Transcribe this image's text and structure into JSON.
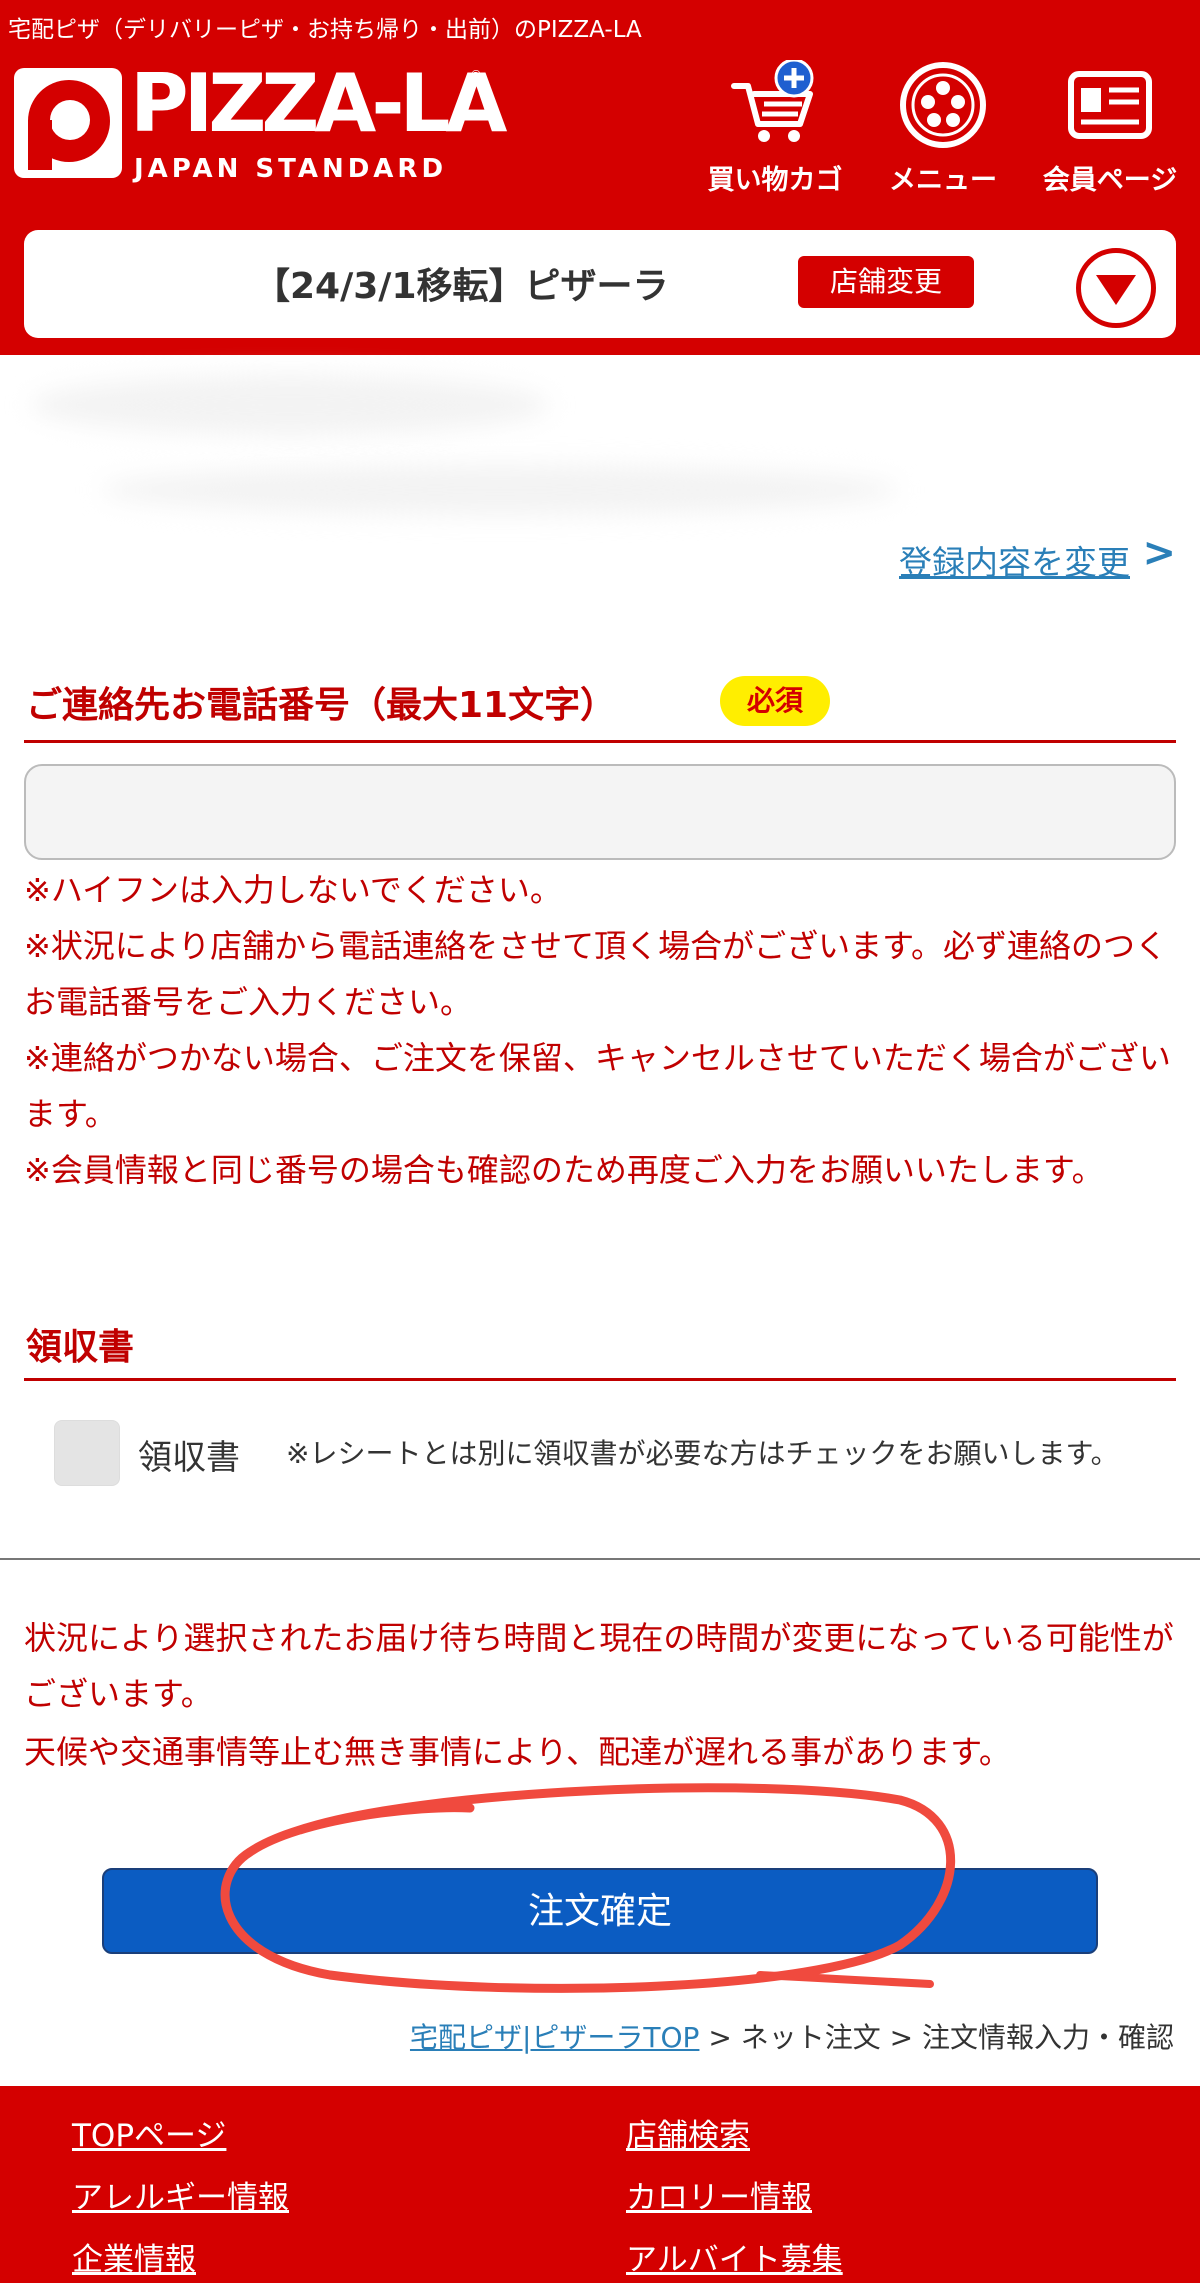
{
  "header": {
    "tagline": "宅配ピザ（デリバリーピザ・お持ち帰り・出前）のPIZZA-LA",
    "logo_word": "PIZZA-LA",
    "logo_sub": "JAPAN STANDARD",
    "nav": {
      "cart_label": "買い物カゴ",
      "menu_label": "メニュー",
      "member_label": "会員ページ"
    }
  },
  "store": {
    "name": "【24/3/1移転】ピザーラ",
    "change_label": "店舗変更"
  },
  "profile": {
    "change_link": "登録内容を変更",
    "change_chevron": ">"
  },
  "phone_section": {
    "title": "ご連絡先お電話番号（最大11文字）",
    "required_label": "必須",
    "value": "",
    "notes": [
      "※ハイフンは入力しないでください。",
      "※状況により店舗から電話連絡をさせて頂く場合がございます。必ず連絡のつくお電話番号をご入力ください。",
      "※連絡がつかない場合、ご注文を保留、キャンセルさせていただく場合がございます。",
      "※会員情報と同じ番号の場合も確認のため再度ご入力をお願いいたします。"
    ]
  },
  "receipt_section": {
    "title": "領収書",
    "checkbox_label": "領収書",
    "note": "※レシートとは別に領収書が必要な方はチェックをお願いします。"
  },
  "delivery_notes": [
    "状況により選択されたお届け待ち時間と現在の時間が変更になっている可能性がございます。",
    "天候や交通事情等止む無き事情により、配達が遅れる事があります。"
  ],
  "order_button_label": "注文確定",
  "breadcrumb": {
    "home": "宅配ピザ|ピザーラTOP",
    "sep": " > ",
    "net_order": "ネット注文",
    "current": "注文情報入力・確認"
  },
  "footer": {
    "links": [
      "TOPページ",
      "店舗検索",
      "アレルギー情報",
      "カロリー情報",
      "企業情報",
      "アルバイト募集"
    ]
  },
  "colors": {
    "brand_red": "#d40000",
    "text_red": "#c00000",
    "button_blue": "#0b5cc2",
    "badge_yellow": "#ffee00",
    "link_blue": "#2a7fb8",
    "annotation_red": "#f04a3e"
  },
  "icons": {
    "cart": "cart-plus-icon",
    "menu": "pizza-icon",
    "member": "member-card-icon",
    "store_toggle": "chevron-down-icon"
  }
}
